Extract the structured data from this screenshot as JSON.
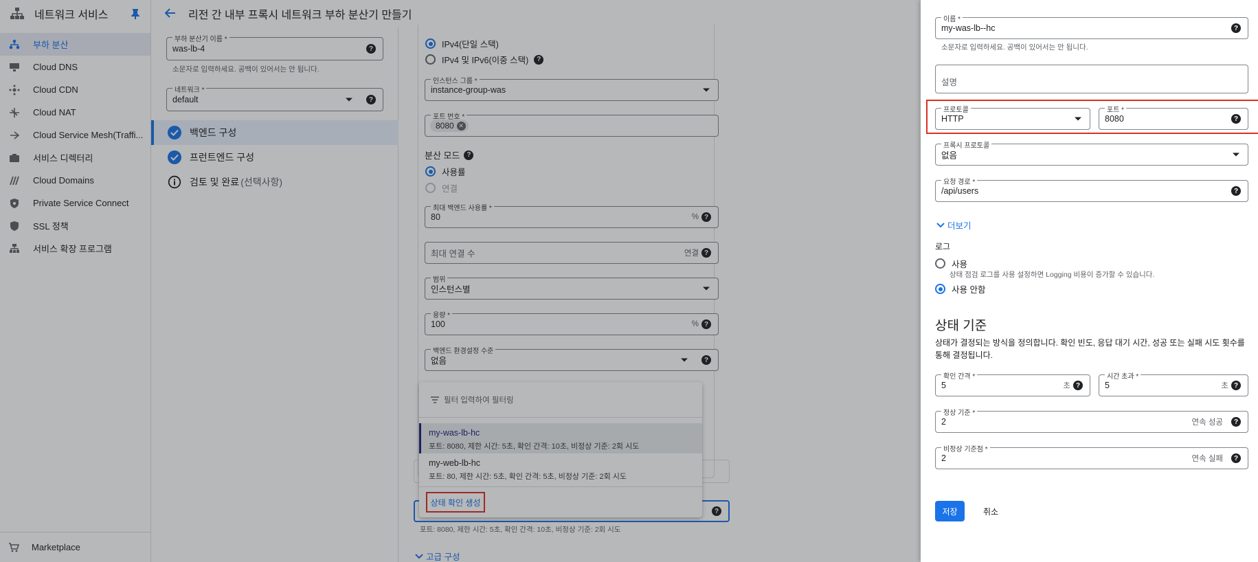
{
  "nav": {
    "title": "네트워크 서비스",
    "items": [
      {
        "label": "부하 분산"
      },
      {
        "label": "Cloud DNS"
      },
      {
        "label": "Cloud CDN"
      },
      {
        "label": "Cloud NAT"
      },
      {
        "label": "Cloud Service Mesh(Traffi..."
      },
      {
        "label": "서비스 디렉터리"
      },
      {
        "label": "Cloud Domains"
      },
      {
        "label": "Private Service Connect"
      },
      {
        "label": "SSL 정책"
      },
      {
        "label": "서비스 확장 프로그램"
      }
    ],
    "marketplace": "Marketplace"
  },
  "header": {
    "title": "리전 간 내부 프록시 네트워크 부하 분산기 만들기"
  },
  "steps_panel": {
    "lb_name_label": "부하 분산기 이름 *",
    "lb_name_value": "was-lb-4",
    "lb_name_hint": "소문자로 입력하세요. 공백이 있어서는 안 됩니다.",
    "network_label": "네트워크 *",
    "network_value": "default",
    "steps": [
      {
        "label": "백엔드 구성"
      },
      {
        "label": "프런트엔드 구성"
      },
      {
        "label": "검토 및 완료",
        "optional": "(선택사항)"
      }
    ]
  },
  "backend_form": {
    "ip_ipv4": "IPv4(단일 스택)",
    "ip_dual": "IPv4 및 IPv6(이중 스택)",
    "instance_group_label": "인스턴스 그룹 *",
    "instance_group_value": "instance-group-was",
    "port_label": "포트 번호 *",
    "port_chip": "8080",
    "balancing_mode_label": "분산 모드",
    "mode_utilization": "사용률",
    "mode_connection": "연결",
    "max_util_label": "최대 백엔드 사용률 *",
    "max_util_value": "80",
    "max_util_suffix": "%",
    "max_conn_placeholder": "최대 연결 수",
    "max_conn_suffix": "연결",
    "scope_label": "범위",
    "scope_value": "인스턴스별",
    "capacity_label": "용량 *",
    "capacity_value": "100",
    "capacity_suffix": "%",
    "pref_label": "백엔드 환경설정 수준",
    "pref_value": "없음",
    "hc_hint": "포트: 8080, 제한 시간: 5초, 확인 간격: 10초, 비정상 기준: 2회 시도",
    "advanced_label": "고급 구성"
  },
  "hc_menu": {
    "filter_placeholder": "필터 입력하여 필터링",
    "options": [
      {
        "name": "my-was-lb-hc",
        "desc": "포트: 8080, 제한 시간: 5초, 확인 간격: 10초, 비정상 기준: 2회 시도"
      },
      {
        "name": "my-web-lb-hc",
        "desc": "포트: 80, 제한 시간: 5초, 확인 간격: 5초, 비정상 기준: 2회 시도"
      }
    ],
    "create_label": "상태 확인 생성"
  },
  "health_check": {
    "name_label": "이름 *",
    "name_value": "my-was-lb--hc",
    "name_hint": "소문자로 입력하세요. 공백이 있어서는 안 됩니다.",
    "desc_placeholder": "설명",
    "protocol_label": "프로토콜",
    "protocol_value": "HTTP",
    "port_label": "포트 *",
    "port_value": "8080",
    "proxy_label": "프록시 프로토콜",
    "proxy_value": "없음",
    "path_label": "요청 경로 *",
    "path_value": "/api/users",
    "more_label": "더보기",
    "log_label": "로그",
    "log_on": "사용",
    "log_on_hint": "상태 점검 로그를 사용 설정하면 Logging 비용이 증가할 수 있습니다.",
    "log_off": "사용 안함",
    "criteria_title": "상태 기준",
    "criteria_desc": "상태가 결정되는 방식을 정의합니다. 확인 빈도, 응답 대기 시간, 성공 또는 실패 시도 횟수를 통해 결정됩니다.",
    "interval_label": "확인 간격 *",
    "interval_value": "5",
    "interval_suffix": "초",
    "timeout_label": "시간 초과 *",
    "timeout_value": "5",
    "timeout_suffix": "초",
    "healthy_label": "정상 기준 *",
    "healthy_value": "2",
    "healthy_suffix": "연속 성공",
    "unhealthy_label": "비정상 기준점 *",
    "unhealthy_value": "2",
    "unhealthy_suffix": "연속 실패",
    "save_label": "저장",
    "cancel_label": "취소"
  },
  "colors": {
    "accent": "#1a73e8",
    "highlight": "#d93025"
  }
}
